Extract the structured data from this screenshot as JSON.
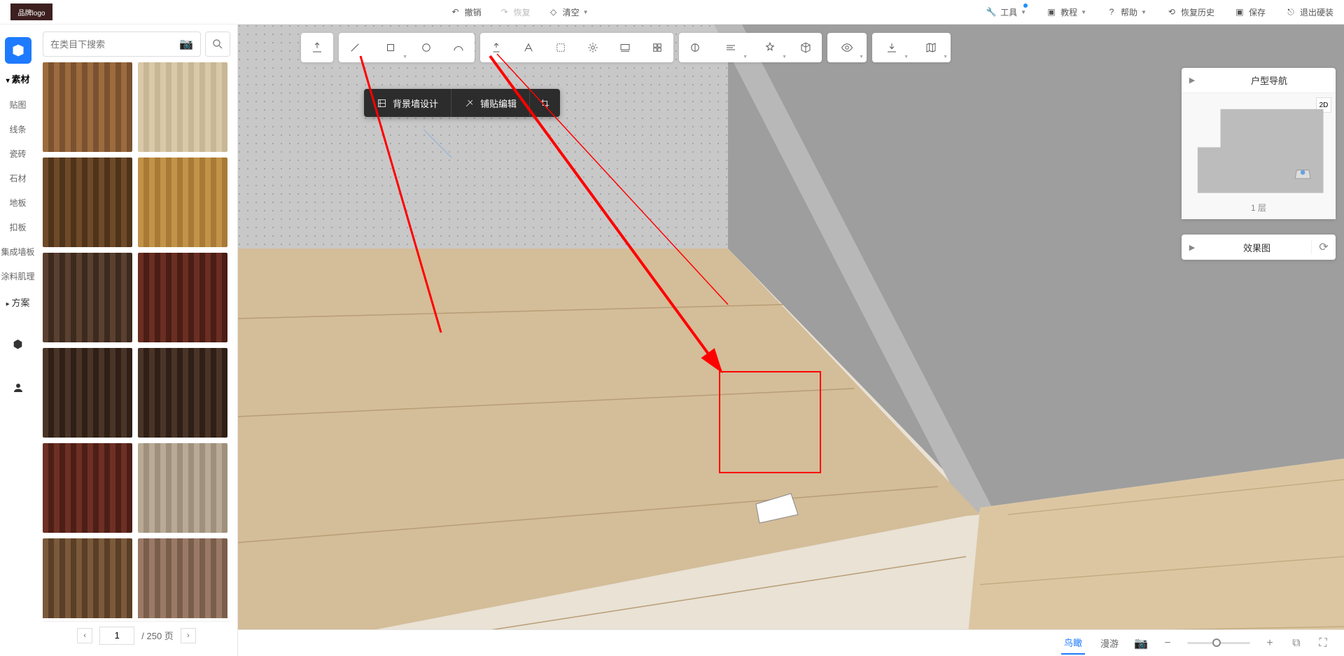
{
  "logo": "品牌logo",
  "topCenter": {
    "undo": "撤销",
    "redo": "恢复",
    "clear": "清空"
  },
  "topRight": {
    "tools": "工具",
    "tutorial": "教程",
    "help": "帮助",
    "history": "恢复历史",
    "save": "保存",
    "exit": "退出硬装"
  },
  "sidebar": {
    "cats": {
      "material": "素材",
      "tiezhi": "贴图",
      "xiantiao": "线条",
      "cizhuan": "瓷砖",
      "shicai": "石材",
      "diban": "地板",
      "kouban": "扣板",
      "jichengqiangban": "集成墙板",
      "tuliaojili": "涂料肌理",
      "fangan": "方案"
    }
  },
  "search": {
    "placeholder": "在类目下搜索"
  },
  "pager": {
    "page": "1",
    "total": "/ 250 页"
  },
  "ctx": {
    "bg": "背景墙设计",
    "tile": "铺贴编辑"
  },
  "navPanel": {
    "title": "户型导航",
    "floor": "1 层",
    "badge": "2D"
  },
  "renderPanel": {
    "title": "效果图"
  },
  "bottom": {
    "bird": "鸟瞰",
    "roam": "漫游"
  },
  "materials": [
    {
      "c1": "#9c6b3e",
      "c2": "#7b5230"
    },
    {
      "c1": "#d9c9a8",
      "c2": "#c8b794"
    },
    {
      "c1": "#6e4a28",
      "c2": "#4f331a"
    },
    {
      "c1": "#c29348",
      "c2": "#a87a36"
    },
    {
      "c1": "#5a4030",
      "c2": "#3d2a1e"
    },
    {
      "c1": "#6b2e22",
      "c2": "#4a1d15"
    },
    {
      "c1": "#4a3428",
      "c2": "#2f1f16"
    },
    {
      "c1": "#4a3428",
      "c2": "#2f1f16"
    },
    {
      "c1": "#6e2f24",
      "c2": "#4d1e16"
    },
    {
      "c1": "#b8aa95",
      "c2": "#9e907c"
    },
    {
      "c1": "#7a5a3a",
      "c2": "#5a3e26"
    },
    {
      "c1": "#9a7a66",
      "c2": "#7a5e4c"
    }
  ]
}
